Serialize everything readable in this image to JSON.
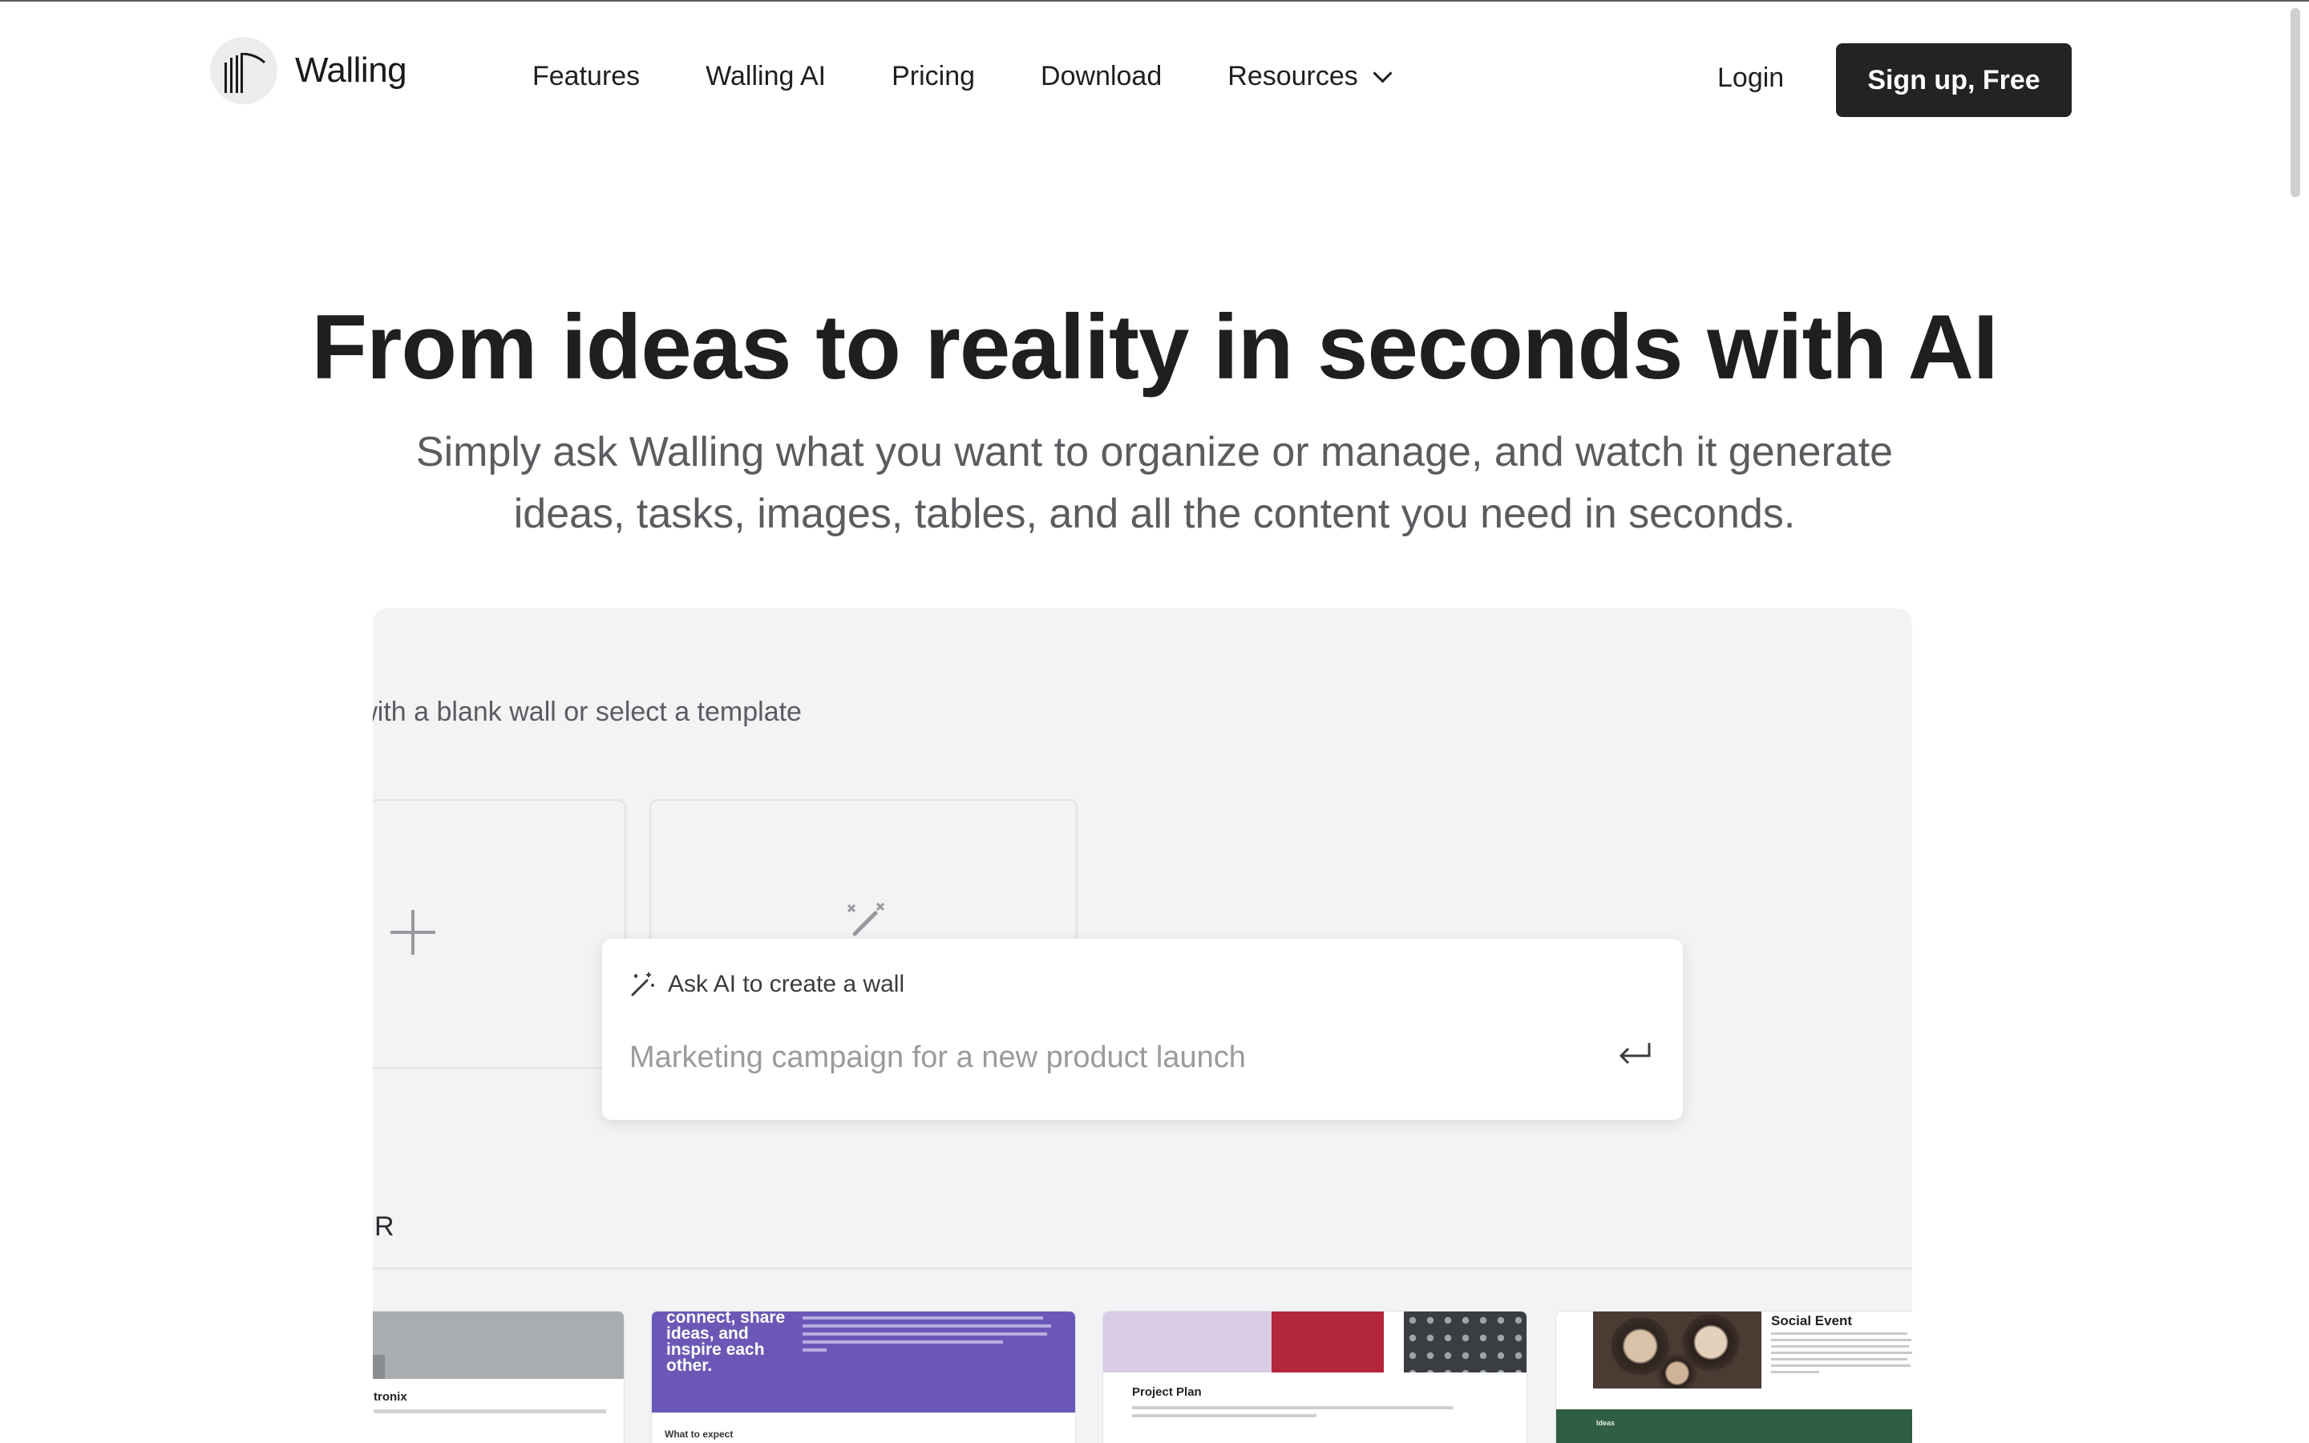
{
  "brand": {
    "name": "Walling"
  },
  "nav": {
    "items": [
      "Features",
      "Walling AI",
      "Pricing",
      "Download"
    ],
    "resources": "Resources"
  },
  "header": {
    "login": "Login",
    "signup": "Sign up, Free"
  },
  "hero": {
    "title": "From ideas to reality in seconds with AI",
    "subtitle_line1": "Simply ask Walling what you want to organize or manage, and watch it generate",
    "subtitle_line2": "ideas, tasks, images, tables, and all the content you need in seconds."
  },
  "demo": {
    "heading": "Start with a blank wall or select a template",
    "ai_box": {
      "label": "Ask AI to create a wall",
      "placeholder": "Marketing campaign for a new product launch"
    },
    "section_heading": "POPULAR",
    "templates": {
      "t1_title": "tronix",
      "t2_headline": "connect, share ideas, and inspire each other.",
      "t2_footer": "What to expect",
      "t3_title": "Project Plan",
      "t4_title": "Social Event",
      "t4_footer": "Ideas"
    }
  },
  "colors": {
    "primary_button": "#232326",
    "panel_bg": "#f3f2f4",
    "template_purple": "#6b58b6",
    "template_green": "#2f5e42"
  },
  "icons": [
    "logo-icon",
    "chevron-down-icon",
    "plus-icon",
    "magic-wand-icon",
    "enter-icon"
  ]
}
